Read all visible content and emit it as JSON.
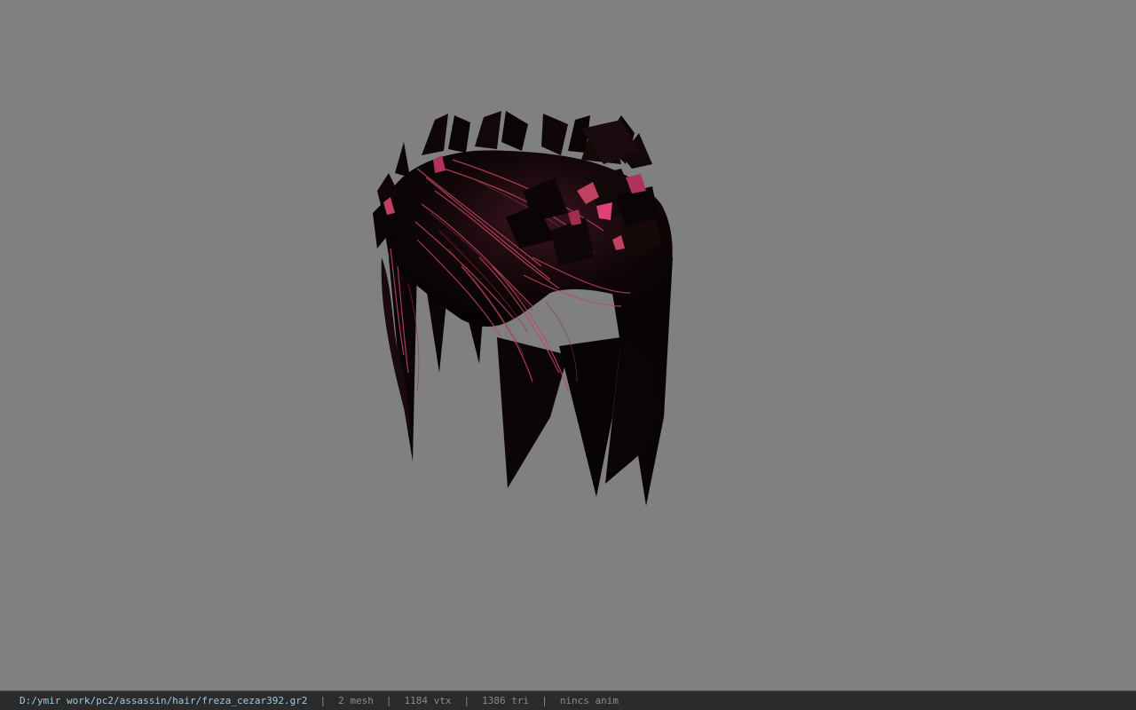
{
  "viewer": {
    "background_color": "#808080",
    "model_palette": {
      "base": "#0a0507",
      "shadow": "#1a0c12",
      "highlight": "#c0485f",
      "accent": "#e0407a"
    }
  },
  "status_bar": {
    "file_path": "D:/ymir work/pc2/assassin/hair/freza_cezar392.gr2",
    "mesh_count": "2 mesh",
    "vertex_count": "1184 vtx",
    "triangle_count": "1386 tri",
    "animation": "nincs anim",
    "separator": "|"
  }
}
